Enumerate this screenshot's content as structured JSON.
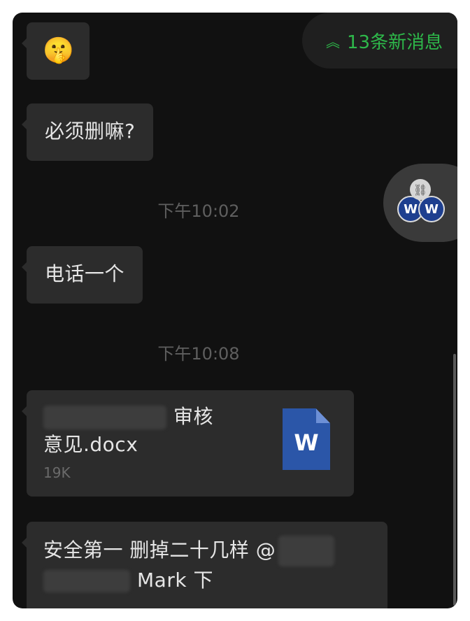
{
  "new_messages": {
    "label": "13条新消息"
  },
  "messages": [
    {
      "type": "emoji",
      "emoji": "🤫"
    },
    {
      "type": "text",
      "text": "必须删嘛?"
    },
    {
      "type": "time",
      "text": "下午10:02"
    },
    {
      "type": "text",
      "text": "电话一个"
    },
    {
      "type": "time",
      "text": "下午10:08"
    },
    {
      "type": "file",
      "name_line1": "审核",
      "name_line2": "意见.docx",
      "size": "19K",
      "icon_letter": "W"
    },
    {
      "type": "text",
      "line1": "安全第一 删掉二十几样 @",
      "line2": "Mark 下"
    }
  ],
  "share": {
    "avatar_letter": "W",
    "link_icon": "link-icon"
  },
  "colors": {
    "background": "#111111",
    "bubble": "#2c2c2c",
    "accent_green": "#2eb84a",
    "word_blue": "#2b56a8"
  }
}
